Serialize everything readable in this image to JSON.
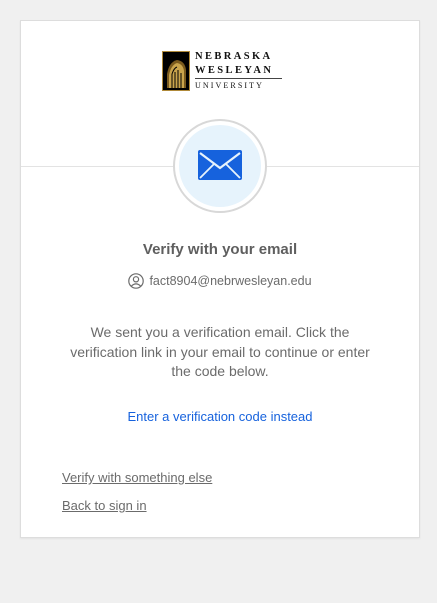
{
  "logo": {
    "line1": "NEBRASKA",
    "line2": "WESLEYAN",
    "line3": "UNIVERSITY"
  },
  "header": {
    "badge_icon": "mail-icon"
  },
  "verify": {
    "title": "Verify with your email",
    "user_icon": "user-circle-icon",
    "email": "fact8904@nebrwesleyan.edu",
    "message": "We sent you a verification email. Click the verification link in your email to continue or enter the code below.",
    "code_link": "Enter a verification code instead"
  },
  "links": {
    "verify_else": "Verify with something else",
    "back_signin": "Back to sign in"
  },
  "colors": {
    "page_background": "#f0f0f0",
    "card_background": "#ffffff",
    "link_blue": "#1662dd",
    "icon_blue": "#1662dd",
    "badge_fill": "#e6f3fc",
    "text_gray": "#6b6b6b"
  }
}
